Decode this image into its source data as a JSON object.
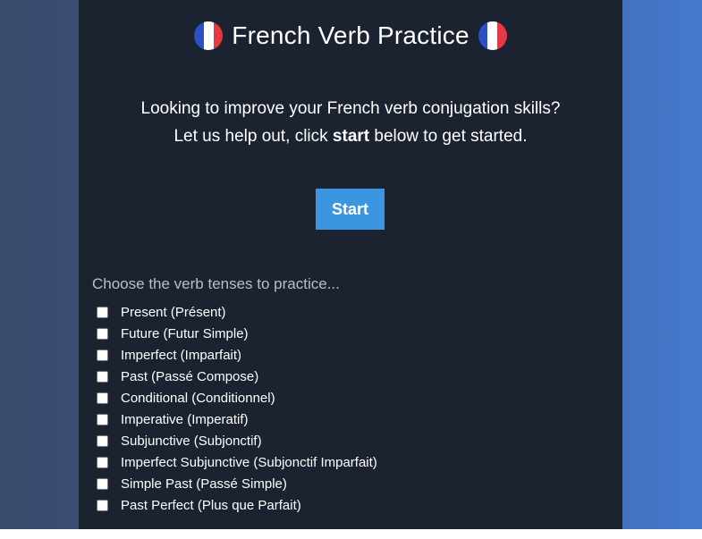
{
  "header": {
    "title": "French Verb Practice",
    "flag_icon": "french-flag-icon"
  },
  "intro": {
    "line1": "Looking to improve your French verb conjugation skills?",
    "line2_before": "Let us help out, click ",
    "line2_bold": "start",
    "line2_after": " below to get started."
  },
  "start_button": {
    "label": "Start"
  },
  "tenses": {
    "prompt": "Choose the verb tenses to practice...",
    "items": [
      {
        "label": "Present (Présent)",
        "checked": false
      },
      {
        "label": "Future (Futur Simple)",
        "checked": false
      },
      {
        "label": "Imperfect (Imparfait)",
        "checked": false
      },
      {
        "label": "Past (Passé Compose)",
        "checked": false
      },
      {
        "label": "Conditional (Conditionnel)",
        "checked": false
      },
      {
        "label": "Imperative (Imperatif)",
        "checked": false
      },
      {
        "label": "Subjunctive (Subjonctif)",
        "checked": false
      },
      {
        "label": "Imperfect Subjunctive (Subjonctif Imparfait)",
        "checked": false
      },
      {
        "label": "Simple Past (Passé Simple)",
        "checked": false
      },
      {
        "label": "Past Perfect (Plus que Parfait)",
        "checked": false
      }
    ]
  },
  "colors": {
    "panel_bg": "#1b2230",
    "accent": "#3c95e0",
    "flag_blue": "#2b4fc7",
    "flag_red": "#e63946"
  }
}
